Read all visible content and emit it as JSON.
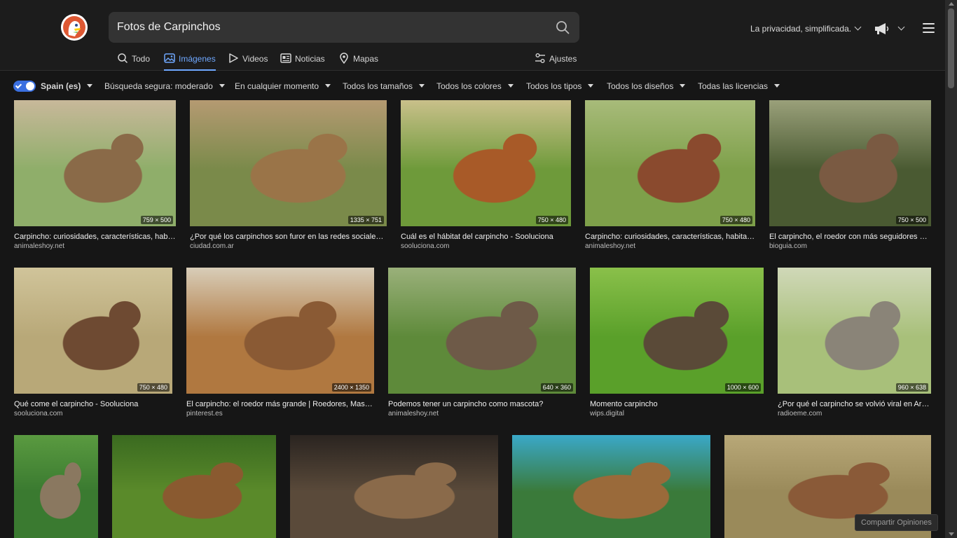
{
  "search": {
    "query": "Fotos de Carpinchos"
  },
  "header": {
    "privacy_label": "La privacidad, simplificada."
  },
  "tabs": [
    {
      "label": "Todo",
      "icon": "search-icon"
    },
    {
      "label": "Imágenes",
      "icon": "image-icon",
      "active": true
    },
    {
      "label": "Videos",
      "icon": "play-icon"
    },
    {
      "label": "Noticias",
      "icon": "news-icon"
    },
    {
      "label": "Mapas",
      "icon": "map-pin-icon"
    }
  ],
  "settings_label": "Ajustes",
  "filters": {
    "region": "Spain (es)",
    "safe_search": "Búsqueda segura: moderado",
    "time": "En cualquier momento",
    "size": "Todos los tamaños",
    "color": "Todos los colores",
    "type": "Todos los tipos",
    "layout": "Todos los diseños",
    "license": "Todas las licencias"
  },
  "results": [
    {
      "title": "Carpincho: curiosidades, características, habitat, a...",
      "source": "animaleshoy.net",
      "dims": "759 × 500",
      "palette": [
        "#8fae6a",
        "#8a6a48",
        "#c8b89a"
      ]
    },
    {
      "title": "¿Por qué los carpinchos son furor en las redes sociales? - ...",
      "source": "ciudad.com.ar",
      "dims": "1335 × 751",
      "palette": [
        "#7a8a4a",
        "#9a7448",
        "#b59a72"
      ]
    },
    {
      "title": "Cuál es el hábitat del carpincho - Sooluciona",
      "source": "sooluciona.com",
      "dims": "750 × 480",
      "palette": [
        "#6e9a3a",
        "#a85a28",
        "#c9c08a"
      ]
    },
    {
      "title": "Carpincho: curiosidades, características, habitat, a...",
      "source": "animaleshoy.net",
      "dims": "750 × 480",
      "palette": [
        "#7ea04a",
        "#8a4a2e",
        "#a8bb7a"
      ]
    },
    {
      "title": "El carpincho, el roedor con más seguidores en ...",
      "source": "bioguia.com",
      "dims": "750 × 500",
      "palette": [
        "#4a5a32",
        "#7a5a42",
        "#9aa07a"
      ]
    },
    {
      "title": "Qué come el carpincho - Sooluciona",
      "source": "sooluciona.com",
      "dims": "750 × 480",
      "palette": [
        "#b8a878",
        "#6e4a32",
        "#d0c49a"
      ]
    },
    {
      "title": "El carpincho: el roedor más grande | Roedores, Mascot...",
      "source": "pinterest.es",
      "dims": "2400 × 1350",
      "palette": [
        "#b07840",
        "#8a5a34",
        "#d8cdb8"
      ]
    },
    {
      "title": "Podemos tener un carpincho como mascota?",
      "source": "animaleshoy.net",
      "dims": "640 × 360",
      "palette": [
        "#5e8a3a",
        "#6e5a48",
        "#9ab07a"
      ]
    },
    {
      "title": "Momento carpincho",
      "source": "wips.digital",
      "dims": "1000 × 600",
      "palette": [
        "#5aa02a",
        "#5a4a38",
        "#8ac04a"
      ]
    },
    {
      "title": "¿Por qué el carpincho se volvió viral en Arge...",
      "source": "radioeme.com",
      "dims": "960 × 638",
      "palette": [
        "#a8c07a",
        "#8a8478",
        "#d0d8b8"
      ]
    },
    {
      "title": "",
      "source": "",
      "dims": "",
      "palette": [
        "#3a7a30",
        "#8a7860",
        "#5a9a40"
      ]
    },
    {
      "title": "",
      "source": "",
      "dims": "",
      "palette": [
        "#5a8a2a",
        "#8a5a30",
        "#3a6a20"
      ]
    },
    {
      "title": "",
      "source": "",
      "dims": "",
      "palette": [
        "#5a4a3a",
        "#8a6a4a",
        "#2a2420"
      ]
    },
    {
      "title": "",
      "source": "",
      "dims": "",
      "palette": [
        "#3a7a3a",
        "#9a6a3a",
        "#3aa8c8"
      ]
    },
    {
      "title": "",
      "source": "",
      "dims": "",
      "palette": [
        "#9a8a5a",
        "#8a5a38",
        "#b8a878"
      ]
    }
  ],
  "feedback_label": "Compartir Opiniones"
}
